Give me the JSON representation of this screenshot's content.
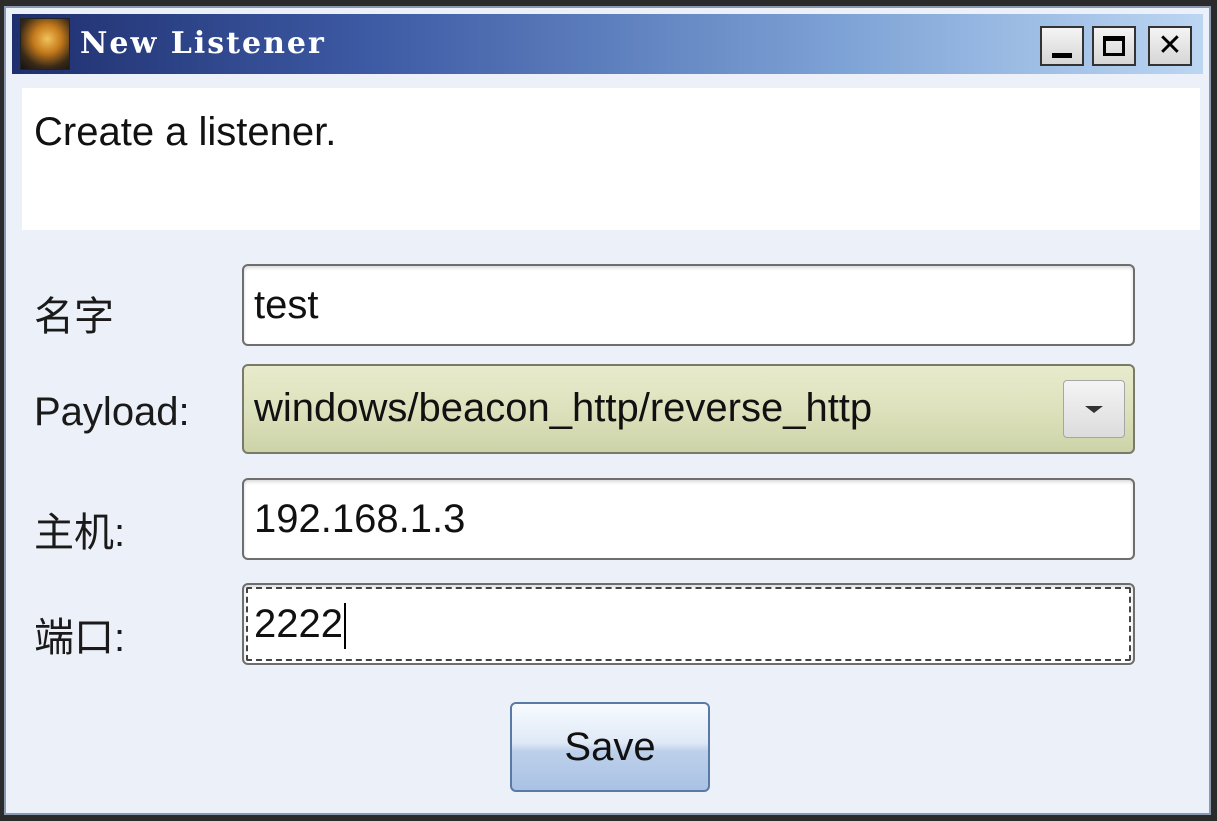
{
  "window": {
    "title": "New Listener",
    "title_buttons": {
      "minimize_icon": "minimize-icon",
      "maximize_icon": "maximize-icon",
      "close_icon": "close-icon",
      "close_glyph": "✕"
    }
  },
  "description": "Create a listener.",
  "form": {
    "name_label": "名字",
    "name_value": "test",
    "payload_label": "Payload:",
    "payload_value": "windows/beacon_http/reverse_http",
    "host_label": "主机:",
    "host_value": "192.168.1.3",
    "port_label": "端口:",
    "port_value": "2222"
  },
  "actions": {
    "save_label": "Save"
  },
  "colors": {
    "titlebar_start": "#1f2f6e",
    "titlebar_end": "#bcd6f2",
    "window_bg": "#ecf0f8",
    "combo_bg": "#dde2bd"
  }
}
